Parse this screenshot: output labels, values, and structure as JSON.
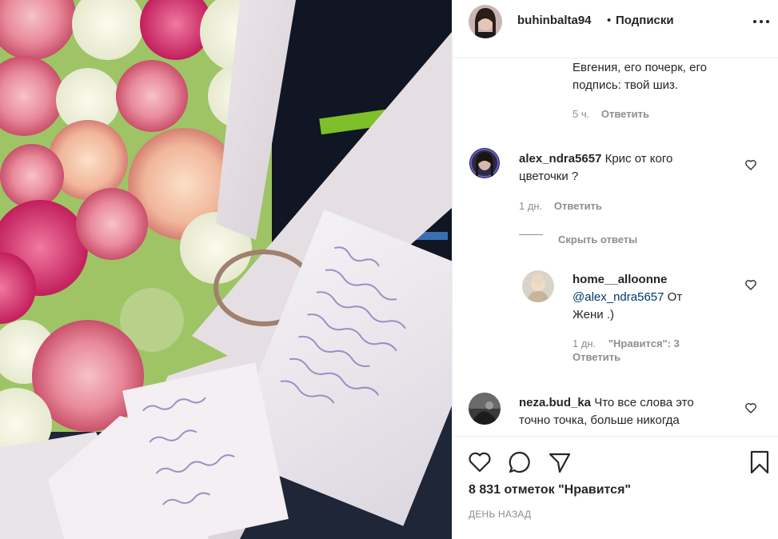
{
  "header": {
    "username": "buhinbalta94",
    "separator": "•",
    "follow_label": "Подписки"
  },
  "comments": [
    {
      "id": "partial",
      "text": "Евгения, его почерк, его подпись: твой шиз.",
      "text_line1": "Евгения, его почерк, его",
      "text_line2": "подпись: твой шиз.",
      "time": "5 ч.",
      "reply_label": "Ответить"
    },
    {
      "id": "alex",
      "username": "alex_ndra5657",
      "text_line1": "Крис от кого",
      "text_line2": "цветочки ?",
      "time": "1 дн.",
      "reply_label": "Ответить",
      "hide_replies_label": "Скрыть ответы"
    },
    {
      "id": "home",
      "username": "home__alloonne",
      "mention": "@alex_ndra5657",
      "text_after_mention": "От",
      "text_line3": "Жени .)",
      "time": "1 дн.",
      "likes": "\"Нравится\": 3",
      "reply_label": "Ответить"
    },
    {
      "id": "neza",
      "username": "neza.bud_ka",
      "text_line1": "Что все слова это",
      "text_line2": "точно точка, больше никогда"
    }
  ],
  "footer": {
    "likes_text": "8 831 отметок \"Нравится\"",
    "time_ago": "ДЕНЬ НАЗАД"
  },
  "icons": {
    "like": "heart-icon",
    "comment": "comment-icon",
    "share": "paper-plane-icon",
    "save": "bookmark-icon",
    "more": "more-options-icon"
  },
  "colors": {
    "text": "#262626",
    "secondary": "#8e8e8e",
    "mention": "#00376b",
    "divider": "#efefef"
  }
}
